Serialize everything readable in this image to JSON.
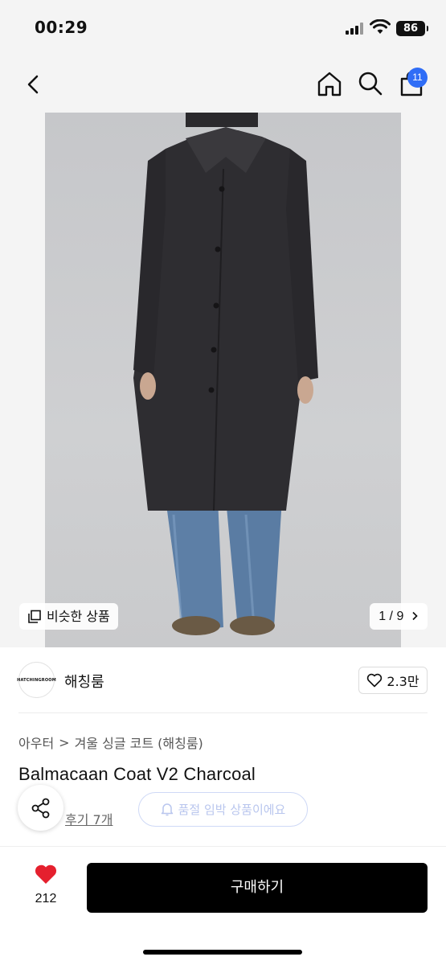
{
  "status_bar": {
    "time": "00:29",
    "battery": "86"
  },
  "header": {
    "cart_count": "11"
  },
  "gallery": {
    "similar_label": "비슷한 상품",
    "pager": "1 / 9"
  },
  "brand": {
    "logo_text": "HATCHINGROOM",
    "name": "해칭룸",
    "likes": "2.3만"
  },
  "breadcrumb": {
    "category": "아우터",
    "separator": ">",
    "subcategory": "겨울 싱글 코트 (해칭룸)"
  },
  "product": {
    "title": "Balmacaan Coat V2 Charcoal",
    "reviews": "후기 7개",
    "soldout_notice": "품절 임박 상품이에요"
  },
  "bottom_bar": {
    "favorite_count": "212",
    "buy_label": "구매하기"
  },
  "colors": {
    "accent": "#2f6df6",
    "heart": "#e5202e",
    "buy": "#000000"
  },
  "icons": [
    "back-icon",
    "home-icon",
    "search-icon",
    "bag-icon",
    "copy-icon",
    "chevron-right-icon",
    "heart-outline-icon",
    "share-icon",
    "bell-icon",
    "heart-filled-icon"
  ]
}
